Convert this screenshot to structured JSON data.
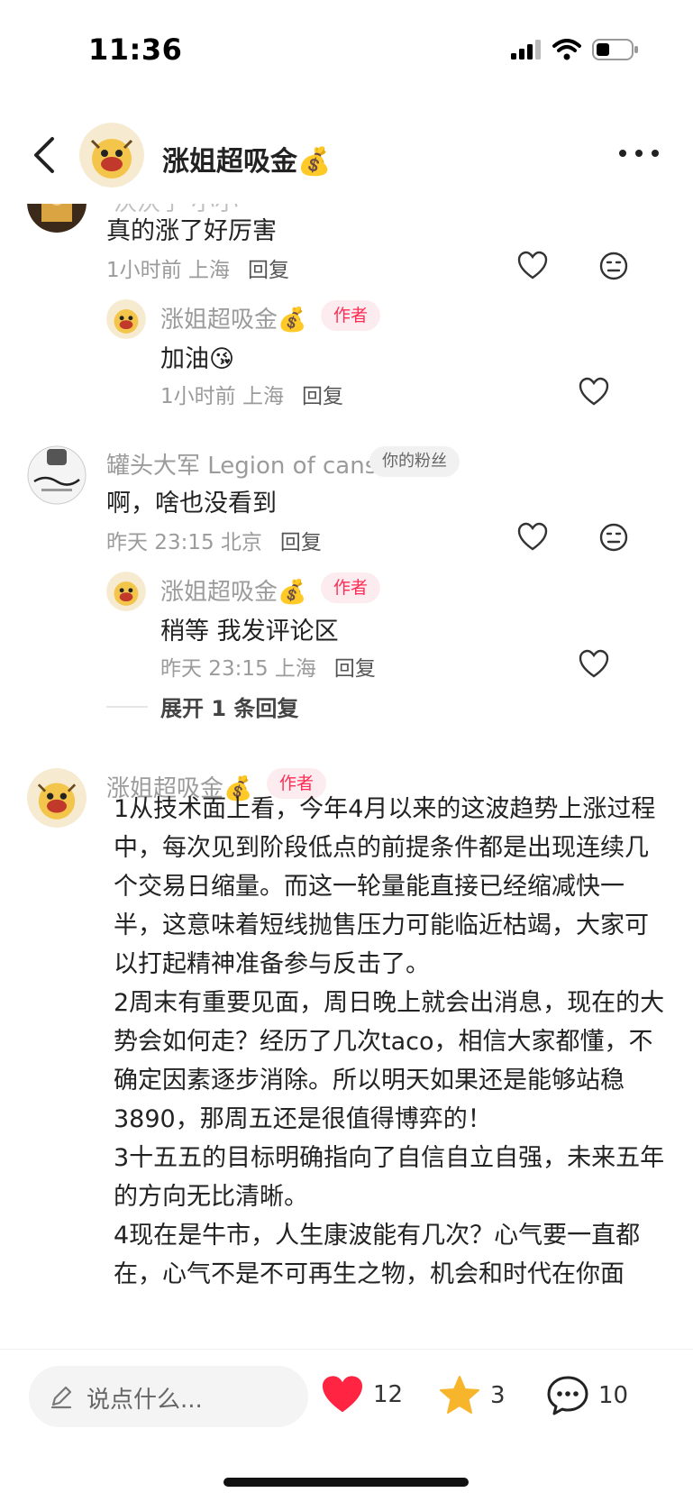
{
  "status": {
    "time": "11:36"
  },
  "header": {
    "title": "涨姐超吸金",
    "title_emoji": "💰"
  },
  "comments": [
    {
      "partial_name": "沃沃子 小小",
      "text": "真的涨了好厉害",
      "time_loc": "1小时前 上海",
      "reply": "回复",
      "replies": [
        {
          "name": "涨姐超吸金",
          "emoji": "💰",
          "tag": "作者",
          "text": "加油",
          "text_emoji": "😘",
          "time_loc": "1小时前 上海",
          "reply": "回复"
        }
      ]
    },
    {
      "name": "罐头大军 Legion of cans",
      "tag": "你的粉丝",
      "text": "啊，啥也没看到",
      "time_loc": "昨天 23:15 北京",
      "reply": "回复",
      "replies": [
        {
          "name": "涨姐超吸金",
          "emoji": "💰",
          "tag": "作者",
          "text": "稍等 我发评论区",
          "time_loc": "昨天 23:15 上海",
          "reply": "回复"
        }
      ],
      "expand": "展开 1 条回复"
    },
    {
      "name": "涨姐超吸金",
      "emoji": "💰",
      "tag": "作者",
      "paragraphs": [
        "1从技术面上看，今年4月以来的这波趋势上涨过程中，每次见到阶段低点的前提条件都是出现连续几个交易日缩量。而这一轮量能直接已经缩减快一半，这意味着短线抛售压力可能临近枯竭，大家可以打起精神准备参与反击了。",
        "2周末有重要见面，周日晚上就会出消息，现在的大势会如何走？经历了几次taco，相信大家都懂，不确定因素逐步消除。所以明天如果还是能够站稳3890，那周五还是很值得博弈的！",
        "3十五五的目标明确指向了自信自立自强，未来五年的方向无比清晰。",
        "4现在是牛市，人生康波能有几次？心气要一直都在，心气不是不可再生之物，机会和时代在你面"
      ]
    }
  ],
  "bottom": {
    "placeholder": "说点什么...",
    "likes": "12",
    "stars": "3",
    "comments": "10"
  },
  "colors": {
    "accent": "#ff2d55",
    "heart": "#ff2442",
    "star": "#f7b52c"
  }
}
